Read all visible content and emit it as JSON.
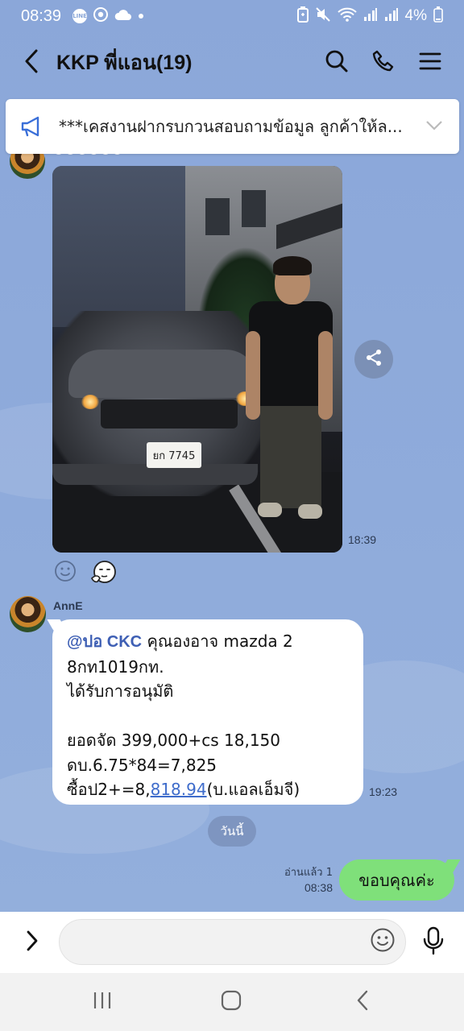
{
  "status_bar": {
    "time": "08:39",
    "line_badge": "LINE",
    "battery": "4%"
  },
  "header": {
    "title": "KKP พี่แอน(19)"
  },
  "announcement": {
    "text": "***เคสงานฝากรบกวนสอบถามข้อมูล ลูกค้าให้ล..."
  },
  "messages": {
    "photo": {
      "plate": "ยก 7745",
      "time": "18:39"
    },
    "text_message": {
      "sender": "AnnE",
      "mention": "@ปอ CKC",
      "line1_rest": "  คุณองอาจ mazda 2",
      "line2": "8กท1019กท.",
      "line3": "ได้รับการอนุมัติ",
      "line4": "ยอดจัด 399,000+cs 18,150",
      "line5": "ดบ.6.75*84=7,825",
      "line6_prefix": "ซื้อป2+=8,",
      "line6_link": "818.94",
      "line6_suffix": "(บ.แอลเอ็มจี)",
      "time": "19:23"
    },
    "date_separator": "วันนี้",
    "outgoing": {
      "read_label": "อ่านแล้ว 1",
      "time": "08:38",
      "text": "ขอบคุณค่ะ"
    }
  },
  "input": {
    "value": "",
    "placeholder": ""
  },
  "colors": {
    "chat_background": "#8aa7d8",
    "outgoing_bubble": "#7fe07a",
    "incoming_bubble": "#ffffff",
    "mention": "#3e5fb4",
    "link": "#3e6ccb"
  },
  "icons": {
    "header": [
      "back-arrow-icon",
      "search-icon",
      "phone-icon",
      "menu-icon"
    ],
    "announcement": [
      "megaphone-icon",
      "chevron-down-icon"
    ],
    "chat": [
      "share-icon",
      "smiley-outline-icon",
      "thinking-face-icon"
    ],
    "input": [
      "chevron-right-icon",
      "emoji-icon",
      "microphone-icon"
    ],
    "nav": [
      "recent-apps-icon",
      "home-icon",
      "back-icon"
    ]
  }
}
